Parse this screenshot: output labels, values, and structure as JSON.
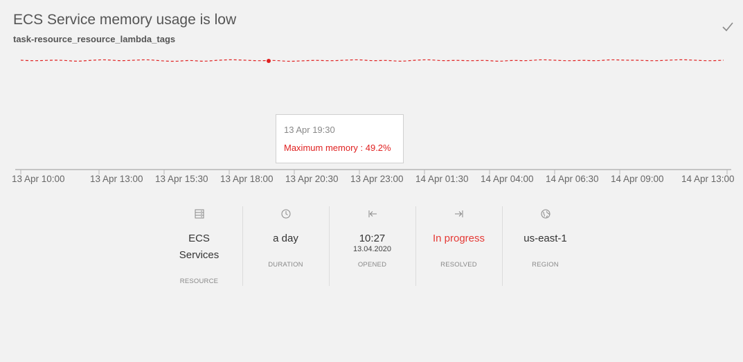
{
  "header": {
    "title": "ECS Service memory usage is low",
    "subtitle": "task-resource_resource_lambda_tags",
    "check_icon": "checkmark-icon"
  },
  "tooltip": {
    "time": "13 Apr 19:30",
    "value": "Maximum memory : 49.2%"
  },
  "chart_data": {
    "type": "line",
    "title": "",
    "xlabel": "",
    "ylabel": "",
    "x_tick_labels": [
      "13 Apr 10:00",
      "13 Apr 13:00",
      "13 Apr 15:30",
      "13 Apr 18:00",
      "13 Apr 20:30",
      "13 Apr 23:00",
      "14 Apr 01:30",
      "14 Apr 04:00",
      "14 Apr 06:30",
      "14 Apr 09:00",
      "14 Apr 13:00"
    ],
    "series": [
      {
        "values": [
          49.2,
          49.1,
          49.2,
          49.2,
          49.0,
          49.2,
          49.3,
          49.1,
          49.2,
          49.3,
          49.1,
          49.0,
          49.2,
          49.0,
          49.2,
          49.3,
          49.2,
          49.1,
          49.2,
          49.0,
          49.1,
          49.2,
          49.1,
          49.2,
          49.3,
          49.1,
          49.2,
          49.0,
          49.2,
          49.3,
          49.1,
          49.2,
          49.1,
          49.2,
          49.0,
          49.2,
          49.1,
          49.3,
          49.2,
          49.1,
          49.2,
          49.1,
          49.3,
          49.2,
          49.2,
          49.1,
          49.2,
          49.3,
          49.2,
          49.1,
          49.2
        ],
        "color": "#e02020",
        "line_style": "dashed"
      }
    ],
    "highlighted_point": {
      "x": "13 Apr 19:30",
      "y": 49.2
    },
    "grid": false
  },
  "info": [
    {
      "icon": "server-icon",
      "value_lines": [
        "ECS",
        "Services"
      ],
      "sub": "",
      "label": "RESOURCE",
      "status": false
    },
    {
      "icon": "clock-icon",
      "value_lines": [
        "a day"
      ],
      "sub": "",
      "label": "DURATION",
      "status": false
    },
    {
      "icon": "arrow-left-bar-icon",
      "value_lines": [
        "10:27"
      ],
      "sub": "13.04.2020",
      "label": "OPENED",
      "status": false
    },
    {
      "icon": "arrow-right-bar-icon",
      "value_lines": [
        "In progress"
      ],
      "sub": "",
      "label": "RESOLVED",
      "status": true
    },
    {
      "icon": "globe-icon",
      "value_lines": [
        "us-east-1"
      ],
      "sub": "",
      "label": "REGION",
      "status": false
    }
  ],
  "colors": {
    "accent_red": "#e02020",
    "status_red": "#e53935"
  }
}
